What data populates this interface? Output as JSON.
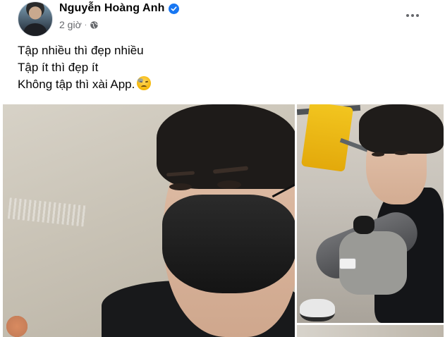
{
  "post": {
    "author_name": "Nguyễn Hoàng Anh",
    "timestamp": "2 giờ",
    "separator": "·",
    "privacy_icon": "globe-icon",
    "verified_icon": "verified-badge-icon",
    "more_icon": "more-options-icon",
    "text_lines": [
      "Tập nhiều thì đẹp nhiều",
      "Tập ít thì đẹp ít",
      "Không tập thì xài App."
    ],
    "emoji": "sad-face-emoji",
    "photos": [
      {
        "name": "selfie-masked-closeup"
      },
      {
        "name": "gym-seated-selfie"
      },
      {
        "name": "third-photo-partial"
      }
    ]
  },
  "colors": {
    "verified_blue": "#1877f2",
    "secondary_text": "#65676b",
    "primary_text": "#050505"
  }
}
